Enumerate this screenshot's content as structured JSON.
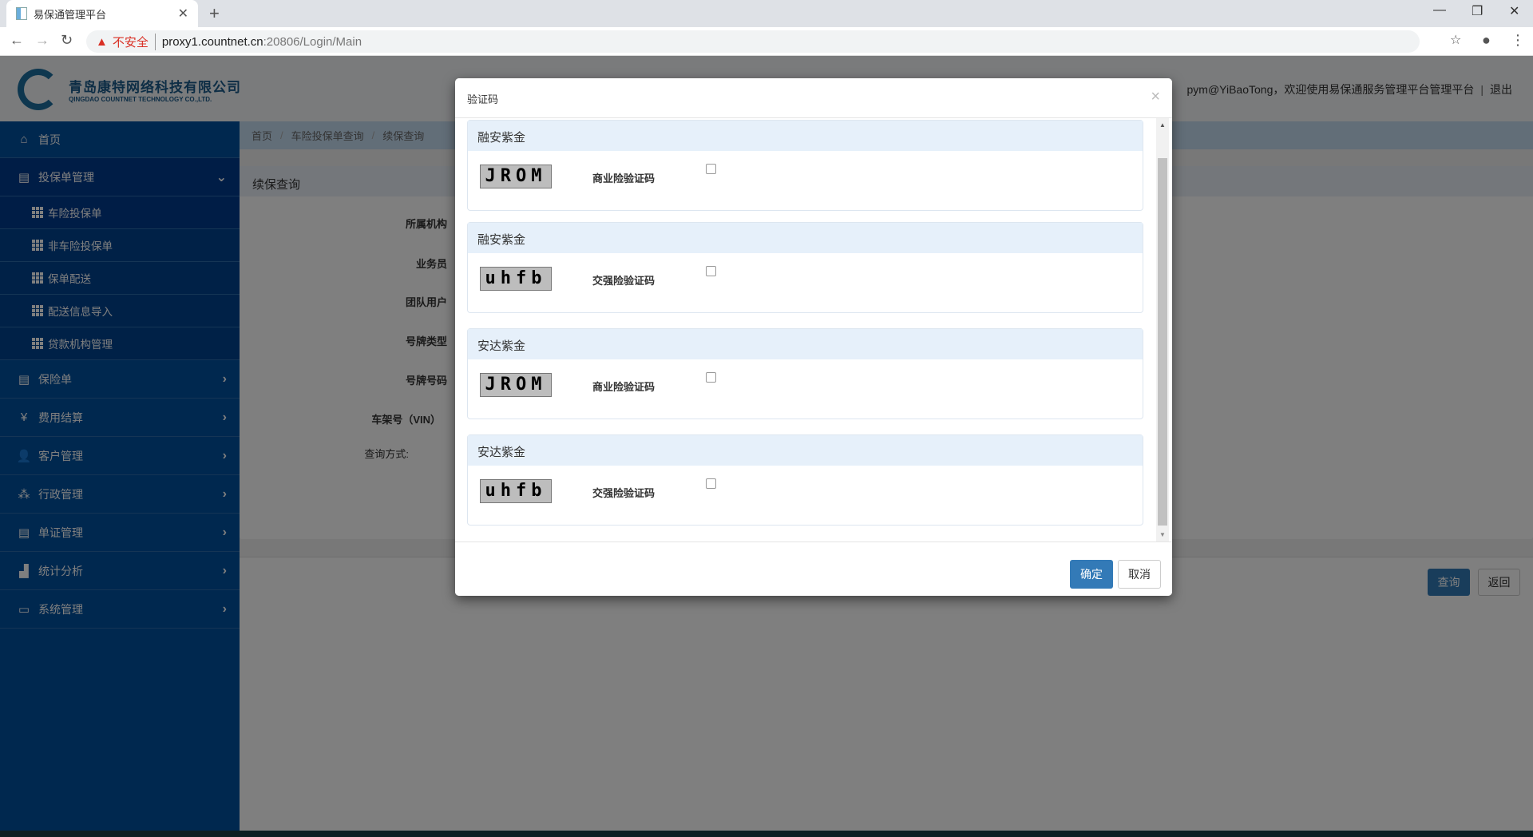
{
  "browser": {
    "tab_title": "易保通管理平台",
    "insecure_label": "不安全",
    "url_host": "proxy1.countnet.cn",
    "url_path": ":20806/Login/Main"
  },
  "header": {
    "company_cn": "青岛康特网络科技有限公司",
    "company_en": "QINGDAO COUNTNET TECHNOLOGY CO.,LTD.",
    "welcome": "pym@YiBaoTong，欢迎使用易保通服务管理平台管理平台",
    "logout": "退出"
  },
  "sidebar": {
    "items": [
      {
        "label": "首页",
        "icon": "home-icon"
      },
      {
        "label": "投保单管理",
        "icon": "document-icon"
      },
      {
        "label": "保险单",
        "icon": "list-icon"
      },
      {
        "label": "费用结算",
        "icon": "money-bag-icon"
      },
      {
        "label": "客户管理",
        "icon": "users-icon"
      },
      {
        "label": "行政管理",
        "icon": "group-icon"
      },
      {
        "label": "单证管理",
        "icon": "list-icon"
      },
      {
        "label": "统计分析",
        "icon": "chart-icon"
      },
      {
        "label": "系统管理",
        "icon": "laptop-icon"
      }
    ],
    "subitems": [
      "车险投保单",
      "非车险投保单",
      "保单配送",
      "配送信息导入",
      "贷款机构管理"
    ]
  },
  "breadcrumb": [
    "首页",
    "车险投保单查询",
    "续保查询"
  ],
  "panel": {
    "title": "续保查询",
    "labels": [
      "所属机构",
      "业务员",
      "团队用户",
      "号牌类型",
      "号牌号码",
      "车架号（VIN）",
      "查询方式:"
    ],
    "query_button": "查询",
    "back_button": "返回"
  },
  "modal": {
    "title": "验证码",
    "close": "×",
    "cards": [
      {
        "company": "融安紫金",
        "captcha": "JROM",
        "label": "商业险验证码"
      },
      {
        "company": "融安紫金",
        "captcha": "uhfb",
        "label": "交强险验证码"
      },
      {
        "company": "安达紫金",
        "captcha": "JROM",
        "label": "商业险验证码"
      },
      {
        "company": "安达紫金",
        "captcha": "uhfb",
        "label": "交强险验证码"
      }
    ],
    "ok": "确定",
    "cancel": "取消"
  }
}
